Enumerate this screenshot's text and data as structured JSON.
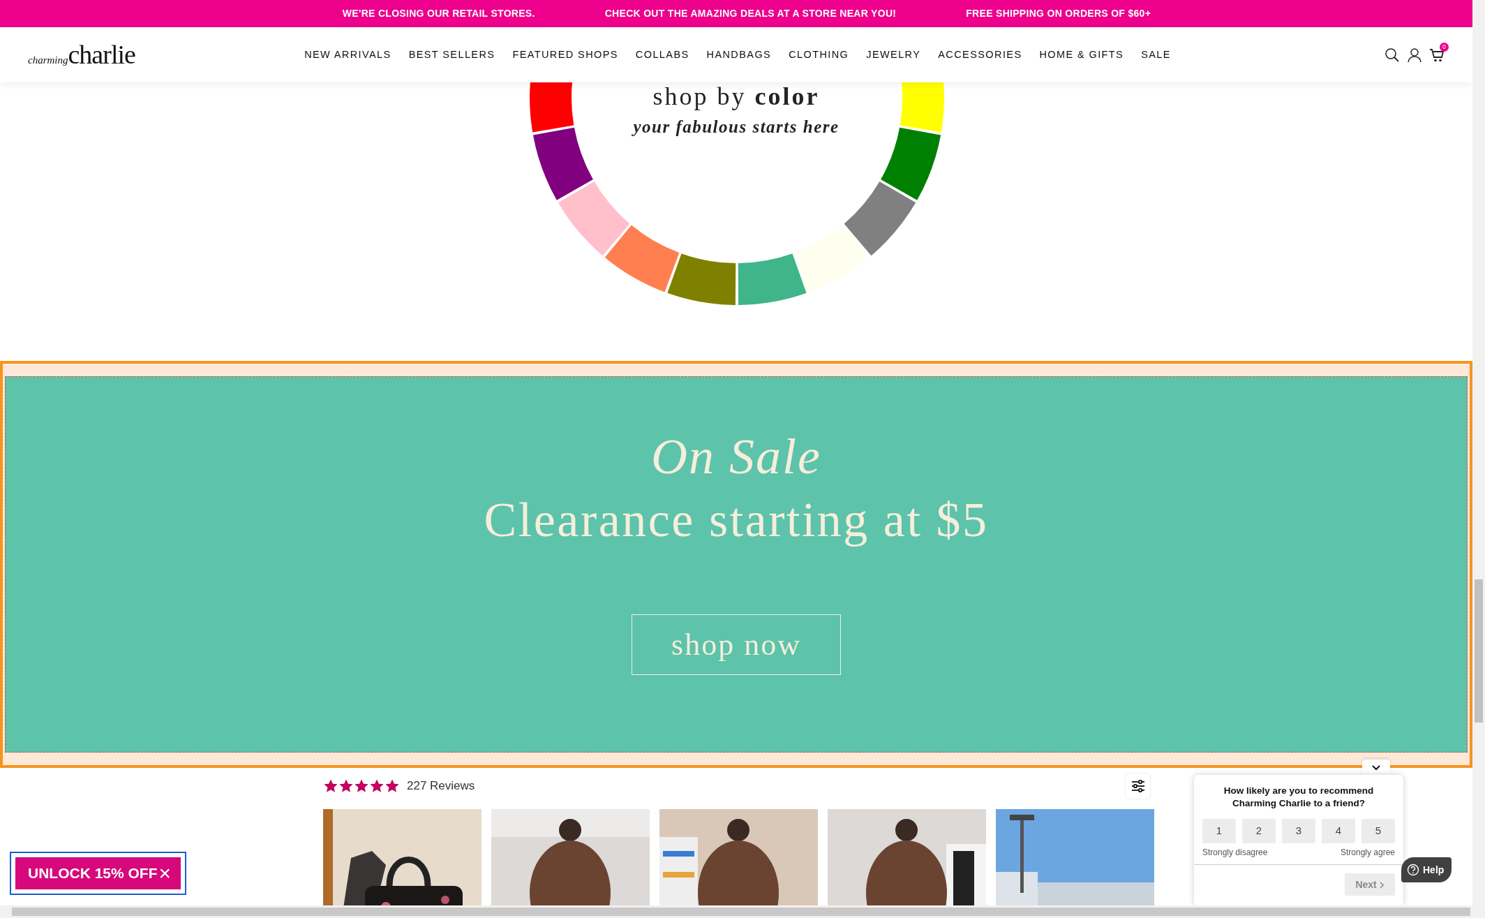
{
  "announcements": [
    "WE'RE CLOSING OUR RETAIL STORES.",
    "CHECK OUT THE AMAZING DEALS AT A STORE NEAR YOU!",
    "FREE SHIPPING ON ORDERS OF $60+"
  ],
  "logo": {
    "small": "charming",
    "large": "charlie"
  },
  "nav": [
    "NEW ARRIVALS",
    "BEST SELLERS",
    "FEATURED SHOPS",
    "COLLABS",
    "HANDBAGS",
    "CLOTHING",
    "JEWELRY",
    "ACCESSORIES",
    "HOME & GIFTS",
    "SALE"
  ],
  "cart_count": "0",
  "color_section": {
    "title": "shop by **color**",
    "subtitle": "your fabulous starts here",
    "swatches": [
      {
        "color": "#ff0000"
      },
      {
        "color": "#800080"
      },
      {
        "color": "#ffc0cb"
      },
      {
        "color": "#ff7f50"
      },
      {
        "color": "#808000"
      },
      {
        "color": "#40b48a"
      },
      {
        "color": "#fffff0"
      },
      {
        "color": "#808080"
      },
      {
        "color": "#008000"
      },
      {
        "color": "#ffff00"
      }
    ]
  },
  "promo": {
    "eyebrow": "On Sale",
    "headline": "Clearance starting at $5",
    "button": "shop now"
  },
  "reviews": {
    "stars": 5,
    "count": "227 Reviews",
    "photos": [
      {
        "kind": "picture"
      },
      {
        "kind": "picture"
      },
      {
        "kind": "picture"
      },
      {
        "kind": "picture"
      },
      {
        "kind": "picture"
      }
    ]
  },
  "unlock": {
    "label": "UNLOCK 15% OFF",
    "close": "×"
  },
  "survey": {
    "question": "How likely are you to recommend Charming Charlie to a friend?",
    "options": [
      "1",
      "2",
      "3",
      "4",
      "5"
    ],
    "low": "Strongly disagree",
    "high": "Strongly agree",
    "next": "Next",
    "next_disabled": true
  },
  "help": "Help"
}
